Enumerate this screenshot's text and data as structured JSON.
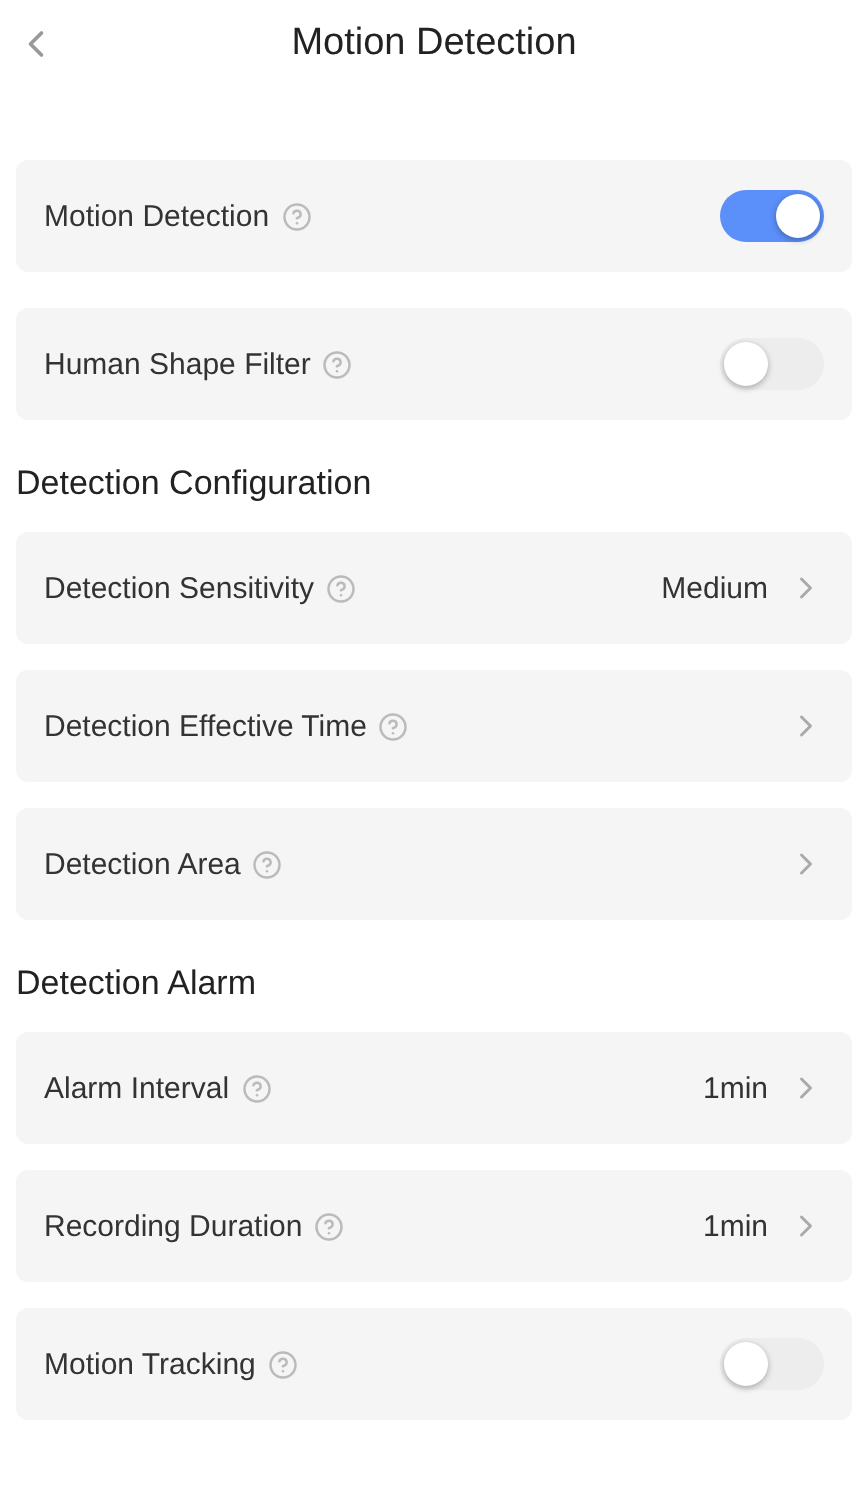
{
  "header": {
    "title": "Motion Detection"
  },
  "sections": [
    {
      "items": [
        {
          "kind": "toggle",
          "label": "Motion Detection",
          "on": true
        },
        {
          "kind": "toggle",
          "label": "Human Shape Filter",
          "on": false
        }
      ]
    },
    {
      "title": "Detection Configuration",
      "items": [
        {
          "kind": "link",
          "label": "Detection Sensitivity",
          "value": "Medium"
        },
        {
          "kind": "link",
          "label": "Detection Effective Time"
        },
        {
          "kind": "link",
          "label": "Detection Area"
        }
      ]
    },
    {
      "title": "Detection Alarm",
      "items": [
        {
          "kind": "link",
          "label": "Alarm Interval",
          "value": "1min"
        },
        {
          "kind": "link",
          "label": "Recording Duration",
          "value": "1min"
        },
        {
          "kind": "toggle",
          "label": "Motion Tracking",
          "on": false
        }
      ]
    }
  ]
}
